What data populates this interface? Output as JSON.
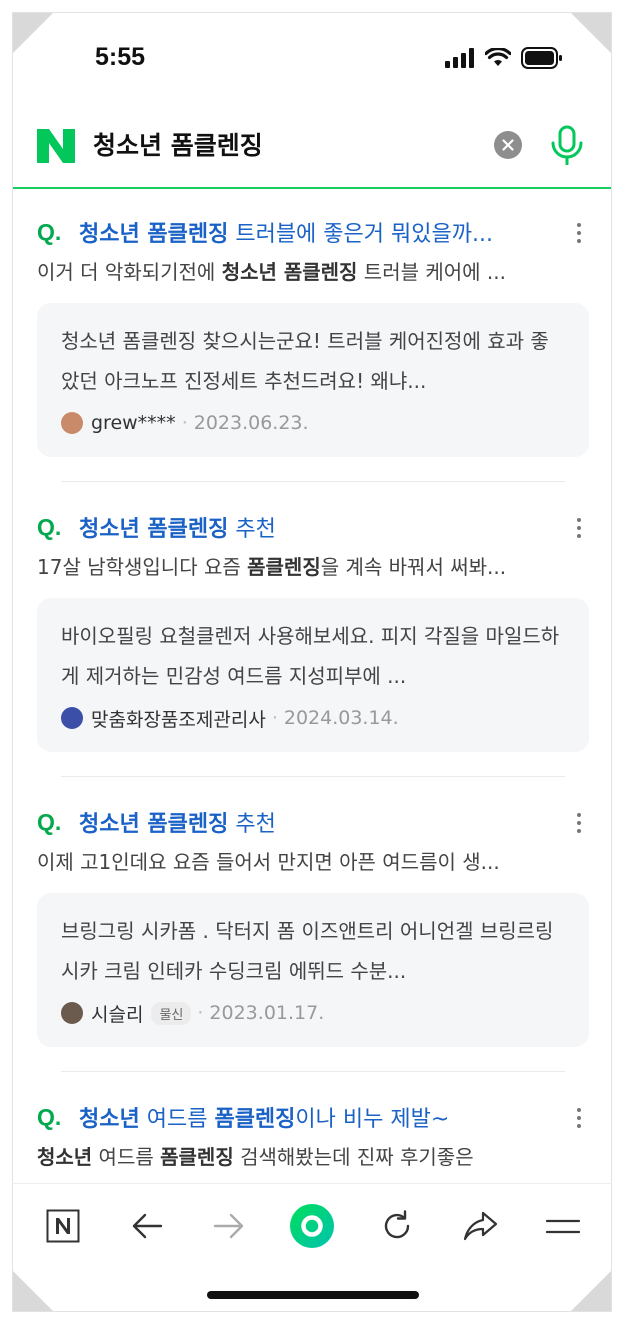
{
  "status_bar": {
    "time": "5:55"
  },
  "search": {
    "query": "청소년 폼클렌징"
  },
  "results": [
    {
      "q_mark": "Q.",
      "title_parts": [
        {
          "text": "청소년 폼클렌징",
          "bold": true
        },
        {
          "text": " 트러블에 좋은거 뭐있을까...",
          "bold": false
        }
      ],
      "snippet_parts": [
        {
          "text": "이거 더 악화되기전에 ",
          "bold": false
        },
        {
          "text": "청소년 폼클렌징",
          "bold": true
        },
        {
          "text": " 트러블 케어에 ...",
          "bold": false
        }
      ],
      "answer": "청소년 폼클렌징 찾으시는군요! 트러블 케어진정에 효과 좋았던 아크노프 진정세트 추천드려요! 왜냐...",
      "author": "grew****",
      "badge": "",
      "date": "2023.06.23.",
      "avatar_color": "#c98a6a"
    },
    {
      "q_mark": "Q.",
      "title_parts": [
        {
          "text": "청소년 폼클렌징",
          "bold": true
        },
        {
          "text": " 추천",
          "bold": false
        }
      ],
      "snippet_parts": [
        {
          "text": "17살 남학생입니다 요즘 ",
          "bold": false
        },
        {
          "text": "폼클렌징",
          "bold": true
        },
        {
          "text": "을 계속 바꿔서 써봐...",
          "bold": false
        }
      ],
      "answer": "바이오필링 요철클렌저 사용해보세요. 피지 각질을 마일드하게 제거하는 민감성 여드름 지성피부에 ...",
      "author": "맞춤화장품조제관리사",
      "badge": "",
      "date": "2024.03.14.",
      "avatar_color": "#3b4fa8"
    },
    {
      "q_mark": "Q.",
      "title_parts": [
        {
          "text": "청소년 폼클렌징",
          "bold": true
        },
        {
          "text": " 추천",
          "bold": false
        }
      ],
      "snippet_parts": [
        {
          "text": "이제 고1인데요 요즘 들어서 만지면 아픈 여드름이 생...",
          "bold": false
        }
      ],
      "answer": "브링그링 시카폼 . 닥터지 폼 이즈앤트리 어니언겔 브링르링 시카 크림 인테카 수딩크림 에뛰드 수분...",
      "author": "시슬리",
      "badge": "물신",
      "date": "2023.01.17.",
      "avatar_color": "#6b5a4e"
    },
    {
      "q_mark": "Q.",
      "title_parts": [
        {
          "text": "청소년",
          "bold": true
        },
        {
          "text": " 여드름 ",
          "bold": false
        },
        {
          "text": "폼클렌징",
          "bold": true
        },
        {
          "text": "이나 비누 제발~",
          "bold": false
        }
      ],
      "snippet_parts": [
        {
          "text": "청소년",
          "bold": true
        },
        {
          "text": " 여드름 ",
          "bold": false
        },
        {
          "text": "폼클렌징",
          "bold": true
        },
        {
          "text": " 검색해봤는데 진짜 후기좋은",
          "bold": false
        }
      ],
      "answer": "",
      "author": "",
      "badge": "",
      "date": "",
      "avatar_color": "#999999"
    }
  ],
  "colors": {
    "brand_green": "#03c75a",
    "link_blue": "#1a62c6",
    "q_green": "#03a94d"
  },
  "icons": {
    "naver": "naver-n-logo",
    "clear": "clear-x-icon",
    "mic": "microphone-icon",
    "nav": [
      "naver-home-icon",
      "back-arrow-icon",
      "forward-arrow-icon",
      "green-dot-icon",
      "refresh-icon",
      "share-icon",
      "menu-icon"
    ]
  }
}
